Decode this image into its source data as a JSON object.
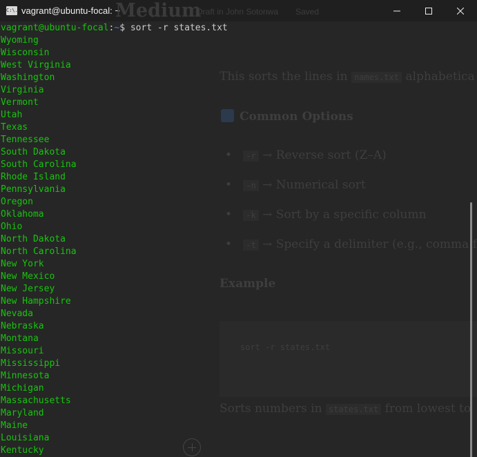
{
  "window": {
    "title": "vagrant@ubuntu-focal: ~",
    "icon_label": "C:\\.",
    "controls": {
      "minimize_icon": "minimize-icon",
      "maximize_icon": "maximize-icon",
      "close_icon": "close-icon"
    }
  },
  "background_page": {
    "brand": "Medium",
    "draft_label": "Draft in John Sotonwa",
    "saved_label": "Saved",
    "intro_before": "This sorts the lines in",
    "intro_code": "names.txt",
    "intro_after": "alphabetica",
    "section_heading": "Common Options",
    "options": [
      {
        "code": "-r",
        "text": "→ Reverse sort (Z–A)"
      },
      {
        "code": "-n",
        "text": "→ Numerical sort"
      },
      {
        "code": "-k",
        "text": "→ Sort by a specific column"
      },
      {
        "code": "-t",
        "text": "→ Specify a delimiter (e.g., comma fo"
      }
    ],
    "example_heading": "Example",
    "example_code": "sort -r states.txt",
    "sorts_before": "Sorts numbers in",
    "sorts_code": "states.txt",
    "sorts_after": "from lowest to"
  },
  "terminal": {
    "prompt_user": "vagrant@ubuntu-focal",
    "prompt_sep": ":",
    "prompt_path": "~",
    "prompt_symbol": "$",
    "command": " sort -r states.txt",
    "output": [
      "Wyoming",
      "Wisconsin",
      "West Virginia",
      "Washington",
      "Virginia",
      "Vermont",
      "Utah",
      "Texas",
      "Tennessee",
      "South Dakota",
      "South Carolina",
      "Rhode Island",
      "Pennsylvania",
      "Oregon",
      "Oklahoma",
      "Ohio",
      "North Dakota",
      "North Carolina",
      "New York",
      "New Mexico",
      "New Jersey",
      "New Hampshire",
      "Nevada",
      "Nebraska",
      "Montana",
      "Missouri",
      "Mississippi",
      "Minnesota",
      "Michigan",
      "Massachusetts",
      "Maryland",
      "Maine",
      "Louisiana",
      "Kentucky"
    ]
  },
  "colors": {
    "output_green": "#16c60c",
    "path_blue": "#3b78ff",
    "background": "#262626",
    "titlebar": "#1f1f1f"
  }
}
